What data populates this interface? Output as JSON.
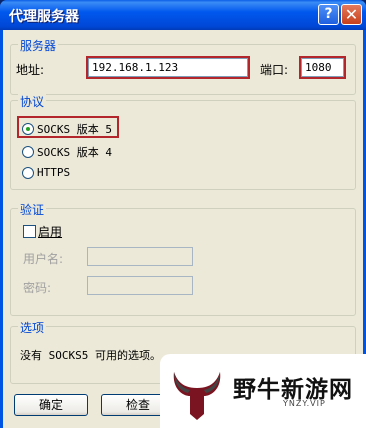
{
  "window": {
    "title": "代理服务器"
  },
  "titlebar": {
    "help_glyph": "?",
    "close_glyph": "✕"
  },
  "server": {
    "legend": "服务器",
    "address_label": "地址:",
    "address_value": "192.168.1.123",
    "port_label": "端口:",
    "port_value": "1080"
  },
  "protocol": {
    "legend": "协议",
    "options": [
      {
        "label": "SOCKS 版本 5",
        "selected": true
      },
      {
        "label": "SOCKS 版本 4",
        "selected": false
      },
      {
        "label": "HTTPS",
        "selected": false
      }
    ]
  },
  "auth": {
    "legend": "验证",
    "enable_label": "启用",
    "enable_checked": false,
    "username_label": "用户名:",
    "username_value": "",
    "password_label": "密码:",
    "password_value": ""
  },
  "options": {
    "legend": "选项",
    "text": "没有 SOCKS5 可用的选项。"
  },
  "buttons": {
    "ok": "确定",
    "check": "检查"
  },
  "watermark": {
    "title": "野牛新游网",
    "subtitle": "YNZY.VIP"
  },
  "colors": {
    "highlight": "#b3262b",
    "legend": "#0046d5",
    "titlebar": "#0058ee"
  }
}
